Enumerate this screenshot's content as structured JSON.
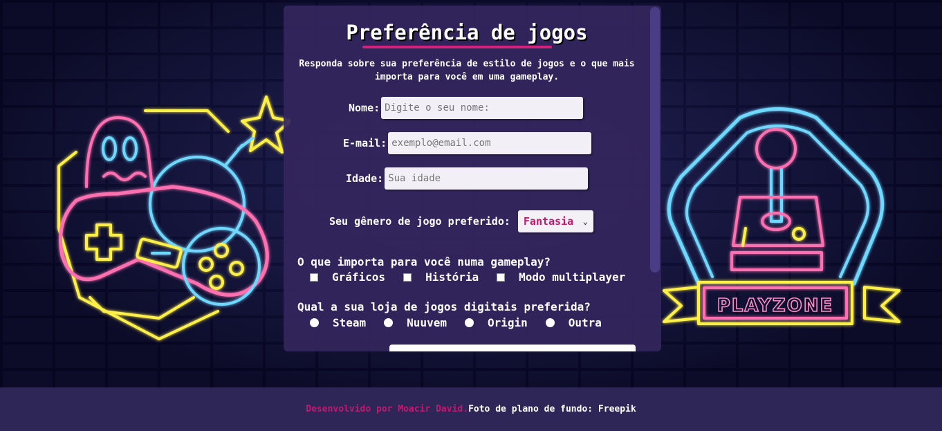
{
  "form": {
    "title": "Preferência de jogos",
    "intro": "Responda sobre sua preferência de estilo de jogos e o que mais importa para você em uma gameplay.",
    "name_label": "Nome:",
    "name_placeholder": "Digite o seu nome:",
    "email_label": "E-mail:",
    "email_placeholder": "exemplo@email.com",
    "age_label": "Idade:",
    "age_placeholder": "Sua idade",
    "genre_label": "Seu gênero de jogo preferido:",
    "genre_selected": "Fantasia",
    "gameplay_question": "O que importa para você numa gameplay?",
    "gameplay_options": [
      "Gráficos",
      "História",
      "Modo multiplayer"
    ],
    "store_question": "Qual a sua loja de jogos digitais preferida?",
    "store_options": [
      "Steam",
      "Nuuvem",
      "Origin",
      "Outra"
    ]
  },
  "background": {
    "sign_text": "PLAYZONE",
    "neon_pink": "#ff6fb1",
    "neon_blue": "#6fd8ff",
    "neon_yellow": "#fff04a"
  },
  "footer": {
    "developer": "Desenvolvido por Moacir David.",
    "credit": "Foto de plano de fundo: Freepik"
  },
  "colors": {
    "accent": "#c2186f",
    "panel": "#34265c",
    "footer": "#2f2658"
  }
}
